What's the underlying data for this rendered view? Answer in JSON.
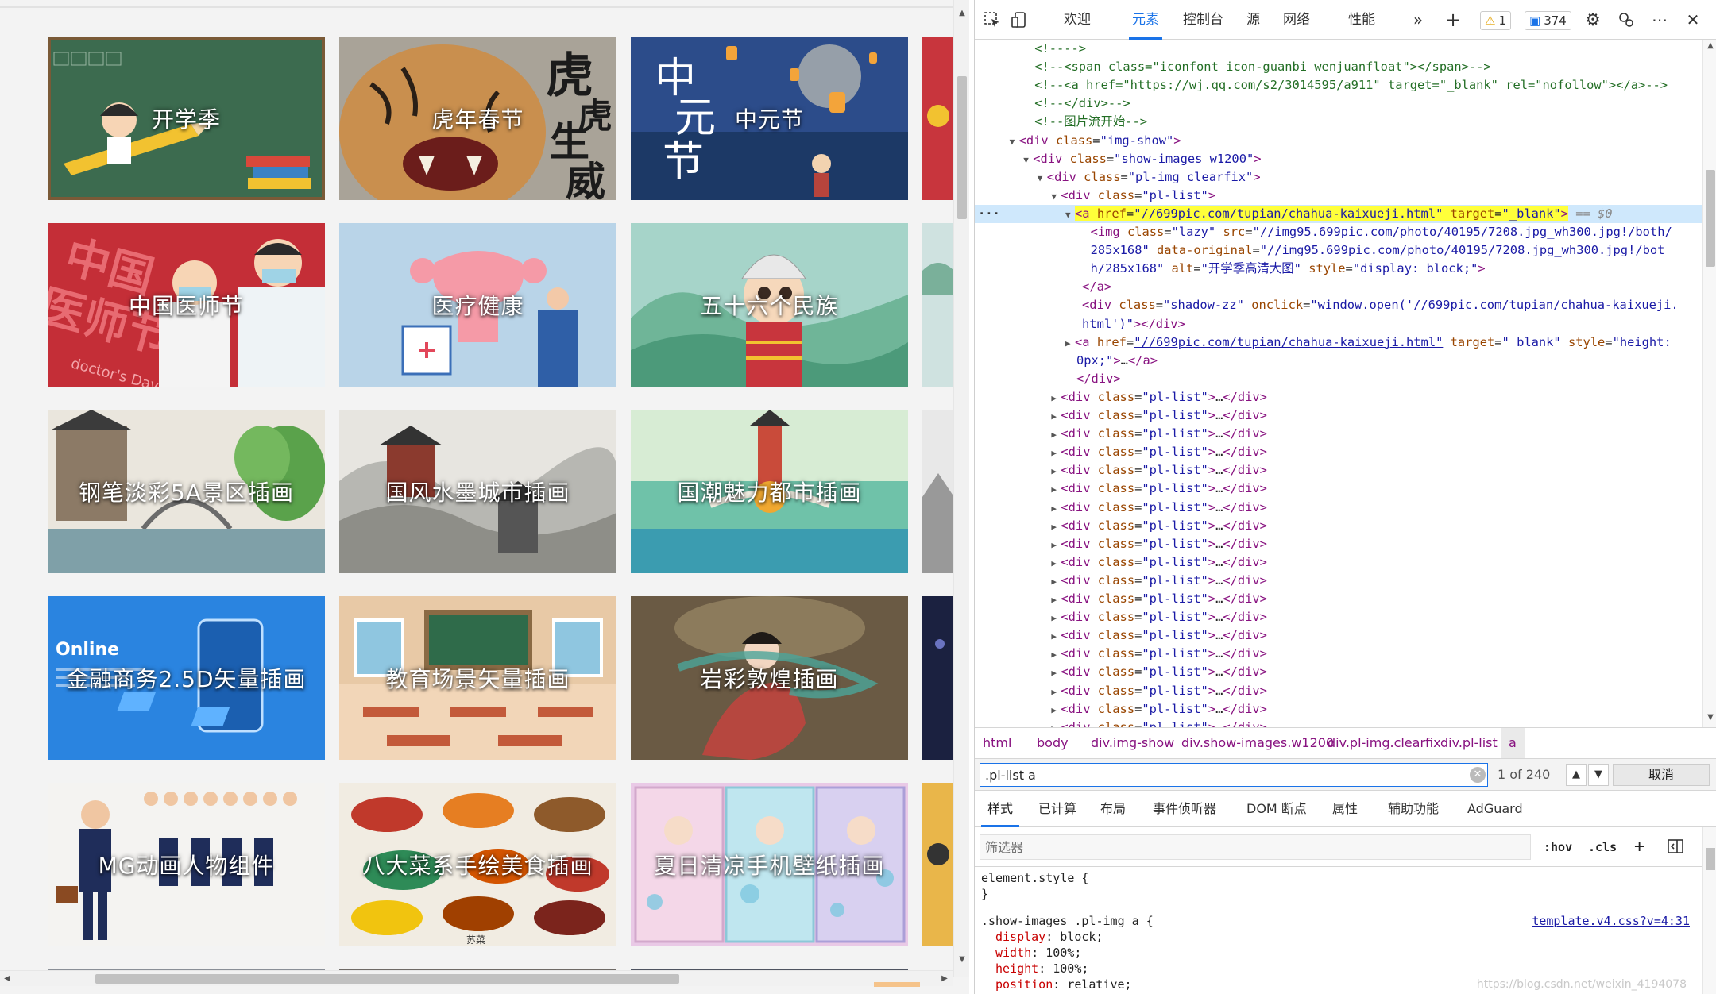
{
  "page": {
    "tiles": [
      {
        "caption": "开学季",
        "row": 0,
        "col": 0,
        "theme": "school"
      },
      {
        "caption": "虎年春节",
        "row": 0,
        "col": 1,
        "theme": "tiger",
        "overlay_text": "虎虎生威"
      },
      {
        "caption": "中元节",
        "row": 0,
        "col": 2,
        "theme": "lantern",
        "overlay_text": "中元节"
      },
      {
        "caption": "中国医师节",
        "row": 1,
        "col": 0,
        "theme": "doctor",
        "overlay_text": "中国医师节 doctor's Day"
      },
      {
        "caption": "医疗健康",
        "row": 1,
        "col": 1,
        "theme": "medical"
      },
      {
        "caption": "五十六个民族",
        "row": 1,
        "col": 2,
        "theme": "ethnic"
      },
      {
        "caption": "钢笔淡彩5A景区插画",
        "row": 2,
        "col": 0,
        "theme": "pen"
      },
      {
        "caption": "国风水墨城市插画",
        "row": 2,
        "col": 1,
        "theme": "ink"
      },
      {
        "caption": "国潮魅力都市插画",
        "row": 2,
        "col": 2,
        "theme": "guochao"
      },
      {
        "caption": "金融商务2.5D矢量插画",
        "row": 3,
        "col": 0,
        "theme": "finance",
        "overlay_text": "Online"
      },
      {
        "caption": "教育场景矢量插画",
        "row": 3,
        "col": 1,
        "theme": "classroom"
      },
      {
        "caption": "岩彩敦煌插画",
        "row": 3,
        "col": 2,
        "theme": "dunhuang"
      },
      {
        "caption": "MG动画人物组件",
        "row": 4,
        "col": 0,
        "theme": "mg"
      },
      {
        "caption": "八大菜系手绘美食插画",
        "row": 4,
        "col": 1,
        "theme": "food",
        "overlay_text": "苏菜"
      },
      {
        "caption": "夏日清凉手机壁纸插画",
        "row": 4,
        "col": 2,
        "theme": "summer"
      }
    ]
  },
  "devtools": {
    "toolbar": {
      "tabs": [
        "欢迎",
        "元素",
        "控制台",
        "源",
        "网络",
        "性能"
      ],
      "active_tab": "元素",
      "more_label": "»",
      "add_label": "+",
      "warnings_count": "1",
      "messages_count": "374"
    },
    "dom_lines": [
      {
        "indent": 2,
        "html": "<span class='cm'>&lt;!----&gt;</span>"
      },
      {
        "indent": 2,
        "html": "<span class='cm'>&lt;!--&lt;span class=\"iconfont icon-guanbi wenjuanfloat\"&gt;&lt;/span&gt;--&gt;</span>"
      },
      {
        "indent": 2,
        "html": "<span class='cm'>&lt;!--&lt;a href=\"https://wj.qq.com/s2/3014595/a911\" target=\"_blank\" rel=\"nofollow\"&gt;&lt;/a&gt;--&gt;</span>"
      },
      {
        "indent": 2,
        "html": "<span class='cm'>&lt;!--&lt;/div&gt;--&gt;</span>"
      },
      {
        "indent": 2,
        "html": "<span class='cm'>&lt;!--图片流开始--&gt;</span>"
      },
      {
        "indent": 1,
        "tri": "▼",
        "html": "<span class='tg'>&lt;div</span> <span class='an'>class</span>=<span class='av'>\"img-show\"</span><span class='tg'>&gt;</span>"
      },
      {
        "indent": 2,
        "tri": "▼",
        "html": "<span class='tg'>&lt;div</span> <span class='an'>class</span>=<span class='av'>\"show-images w1200\"</span><span class='tg'>&gt;</span>"
      },
      {
        "indent": 3,
        "tri": "▼",
        "html": "<span class='tg'>&lt;div</span> <span class='an'>class</span>=<span class='av'>\"pl-img clearfix\"</span><span class='tg'>&gt;</span>"
      },
      {
        "indent": 4,
        "tri": "▼",
        "html": "<span class='tg'>&lt;div</span> <span class='an'>class</span>=<span class='av'>\"pl-list\"</span><span class='tg'>&gt;</span>"
      },
      {
        "indent": 5,
        "tri": "▼",
        "hl": true,
        "dots": true,
        "html": "<span class='sel-hl'><span class='tg'>&lt;a</span> <span class='an'>href</span>=<span class='av'>\"//699pic.com/tupian/chahua-kaixueji.html\"</span> <span class='an'>target</span>=<span class='av'>\"_blank\"</span><span class='tg'>&gt;</span></span> <span class='eq'>== $0</span>"
      },
      {
        "indent": 6,
        "html": "<span class='tg'>&lt;img</span> <span class='an'>class</span>=<span class='av'>\"lazy\"</span> <span class='an'>src</span>=<span class='av'>\"//img95.699pic.com/photo/40195/7208.jpg_wh300.jpg!/both/</span>"
      },
      {
        "indent": 6,
        "html": "<span class='av'>285x168\"</span> <span class='an'>data-original</span>=<span class='av'>\"//img95.699pic.com/photo/40195/7208.jpg_wh300.jpg!/bot</span>"
      },
      {
        "indent": 6,
        "html": "<span class='av'>h/285x168\"</span> <span class='an'>alt</span>=<span class='av'>\"开学季高清大图\"</span> <span class='an'>style</span>=<span class='av'>\"display: block;\"</span><span class='tg'>&gt;</span>"
      },
      {
        "indent": 5.4,
        "html": "<span class='tg'>&lt;/a&gt;</span>"
      },
      {
        "indent": 5.4,
        "html": "<span class='tg'>&lt;div</span> <span class='an'>class</span>=<span class='av'>\"shadow-zz\"</span> <span class='an'>onclick</span>=<span class='av'>\"window.open('//699pic.com/tupian/chahua-kaixueji.</span>"
      },
      {
        "indent": 5.4,
        "html": "<span class='av'>html')\"</span><span class='tg'>&gt;&lt;/div&gt;</span>"
      },
      {
        "indent": 5,
        "tri": "▶",
        "html": "<span class='tg'>&lt;a</span> <span class='an'>href</span>=<span class='avl'>\"//699pic.com/tupian/chahua-kaixueji.html\"</span> <span class='an'>target</span>=<span class='av'>\"_blank\"</span> <span class='an'>style</span>=<span class='av'>\"height:</span>"
      },
      {
        "indent": 5,
        "html": "<span class='av'>0px;\"</span><span class='tg'>&gt;</span>…<span class='tg'>&lt;/a&gt;</span>"
      },
      {
        "indent": 5,
        "html": "<span class='tg'>&lt;/div&gt;</span>"
      }
    ],
    "collapsed_rows_count": 19,
    "collapsed_row_html": "<span class='tg'>&lt;div</span> <span class='an'>class</span>=<span class='av'>\"pl-list\"</span><span class='tg'>&gt;</span>…<span class='tg'>&lt;/div&gt;</span>",
    "breadcrumb": [
      "html",
      "body",
      "div.img-show",
      "div.show-images.w1200",
      "div.pl-img.clearfix",
      "div.pl-list",
      "a"
    ],
    "search": {
      "value": ".pl-list a",
      "match_count": "1 of 240",
      "cancel_label": "取消"
    },
    "styles_tabs": [
      "样式",
      "已计算",
      "布局",
      "事件侦听器",
      "DOM 断点",
      "属性",
      "辅助功能",
      "AdGuard"
    ],
    "active_styles_tab": "样式",
    "filter": {
      "placeholder": "筛选器",
      "hov_label": ":hov",
      "cls_label": ".cls",
      "add_label": "+"
    },
    "css": {
      "element_style_open": "element.style {",
      "element_style_close": "}",
      "rule_selector": ".show-images .pl-img a {",
      "rule_source": "template.v4.css?v=4:31",
      "declarations": [
        {
          "prop": "display",
          "value": "block;"
        },
        {
          "prop": "width",
          "value": "100%;"
        },
        {
          "prop": "height",
          "value": "100%;"
        },
        {
          "prop": "position",
          "value": "relative;"
        }
      ]
    },
    "watermark": "https://blog.csdn.net/weixin_4194078"
  }
}
